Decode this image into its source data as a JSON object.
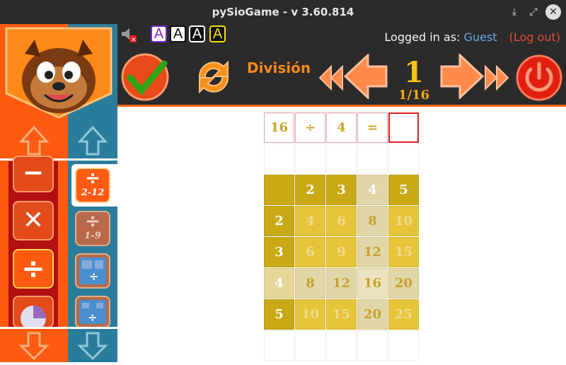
{
  "window": {
    "title": "pySioGame - v 3.60.814",
    "controls": [
      "download-icon",
      "maximize-icon",
      "close-icon"
    ]
  },
  "infobar": {
    "font_buttons": [
      "A",
      "A",
      "A",
      "A"
    ],
    "logged_in_label": "Logged in as:",
    "user": "Guest",
    "logout": "(Log out)"
  },
  "toolbar": {
    "game_title": "División",
    "level": "1",
    "level_fraction": "1/16"
  },
  "sidebar": {
    "categories": [
      "minus",
      "multiply",
      "divide",
      "fractions"
    ],
    "games": [
      {
        "symbol": "÷",
        "range": "2-12"
      },
      {
        "symbol": "÷",
        "range": "1-9"
      },
      {
        "symbol": "÷",
        "range": ""
      },
      {
        "symbol": "÷",
        "range": ""
      }
    ]
  },
  "equation": [
    "16",
    "÷",
    "4",
    "=",
    ""
  ],
  "grid": {
    "headers": [
      "2",
      "3",
      "4",
      "5"
    ],
    "rows": [
      [
        "2",
        "4",
        "6",
        "8",
        "10"
      ],
      [
        "3",
        "6",
        "9",
        "12",
        "15"
      ],
      [
        "4",
        "8",
        "12",
        "16",
        "20"
      ],
      [
        "5",
        "10",
        "15",
        "20",
        "25"
      ]
    ]
  },
  "colors": {
    "orange": "#ff5a12",
    "teal": "#2a7d9a",
    "gold": "#c9a915",
    "dark": "#2b2b2b"
  }
}
